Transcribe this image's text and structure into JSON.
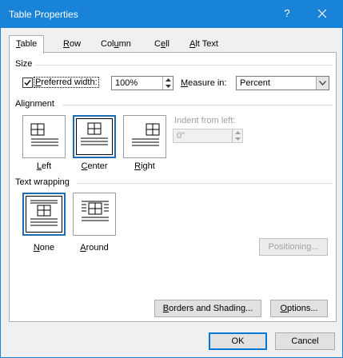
{
  "window": {
    "title": "Table Properties",
    "help_glyph": "?",
    "accent_color": "#1883d7"
  },
  "tabs": [
    {
      "pre": "",
      "key": "T",
      "post": "able",
      "active": true
    },
    {
      "pre": "",
      "key": "R",
      "post": "ow",
      "active": false
    },
    {
      "pre": "Col",
      "key": "u",
      "post": "mn",
      "active": false
    },
    {
      "pre": "C",
      "key": "e",
      "post": "ll",
      "active": false
    },
    {
      "pre": "",
      "key": "A",
      "post": "lt Text",
      "active": false
    }
  ],
  "size": {
    "group_label": "Size",
    "preferred_width": {
      "pre": "",
      "key": "P",
      "post": "referred width:",
      "checked": true
    },
    "width_value": "100%",
    "measure_in": {
      "pre": "",
      "key": "M",
      "post": "easure in:"
    },
    "measure_value": "Percent"
  },
  "alignment": {
    "group_label": "Alignment",
    "options": [
      {
        "pre": "",
        "key": "L",
        "post": "eft",
        "selected": false
      },
      {
        "pre": "",
        "key": "C",
        "post": "enter",
        "selected": true
      },
      {
        "pre": "",
        "key": "R",
        "post": "ight",
        "selected": false
      }
    ],
    "indent_label": "Indent from left:",
    "indent_value": "0\""
  },
  "text_wrapping": {
    "group_label": "Text wrapping",
    "options": [
      {
        "pre": "",
        "key": "N",
        "post": "one",
        "selected": true
      },
      {
        "pre": "",
        "key": "A",
        "post": "round",
        "selected": false
      }
    ],
    "positioning_label": "Positioning..."
  },
  "buttons": {
    "borders": {
      "pre": "",
      "key": "B",
      "post": "orders and Shading..."
    },
    "options": {
      "pre": "",
      "key": "O",
      "post": "ptions..."
    },
    "ok": "OK",
    "cancel": "Cancel"
  }
}
